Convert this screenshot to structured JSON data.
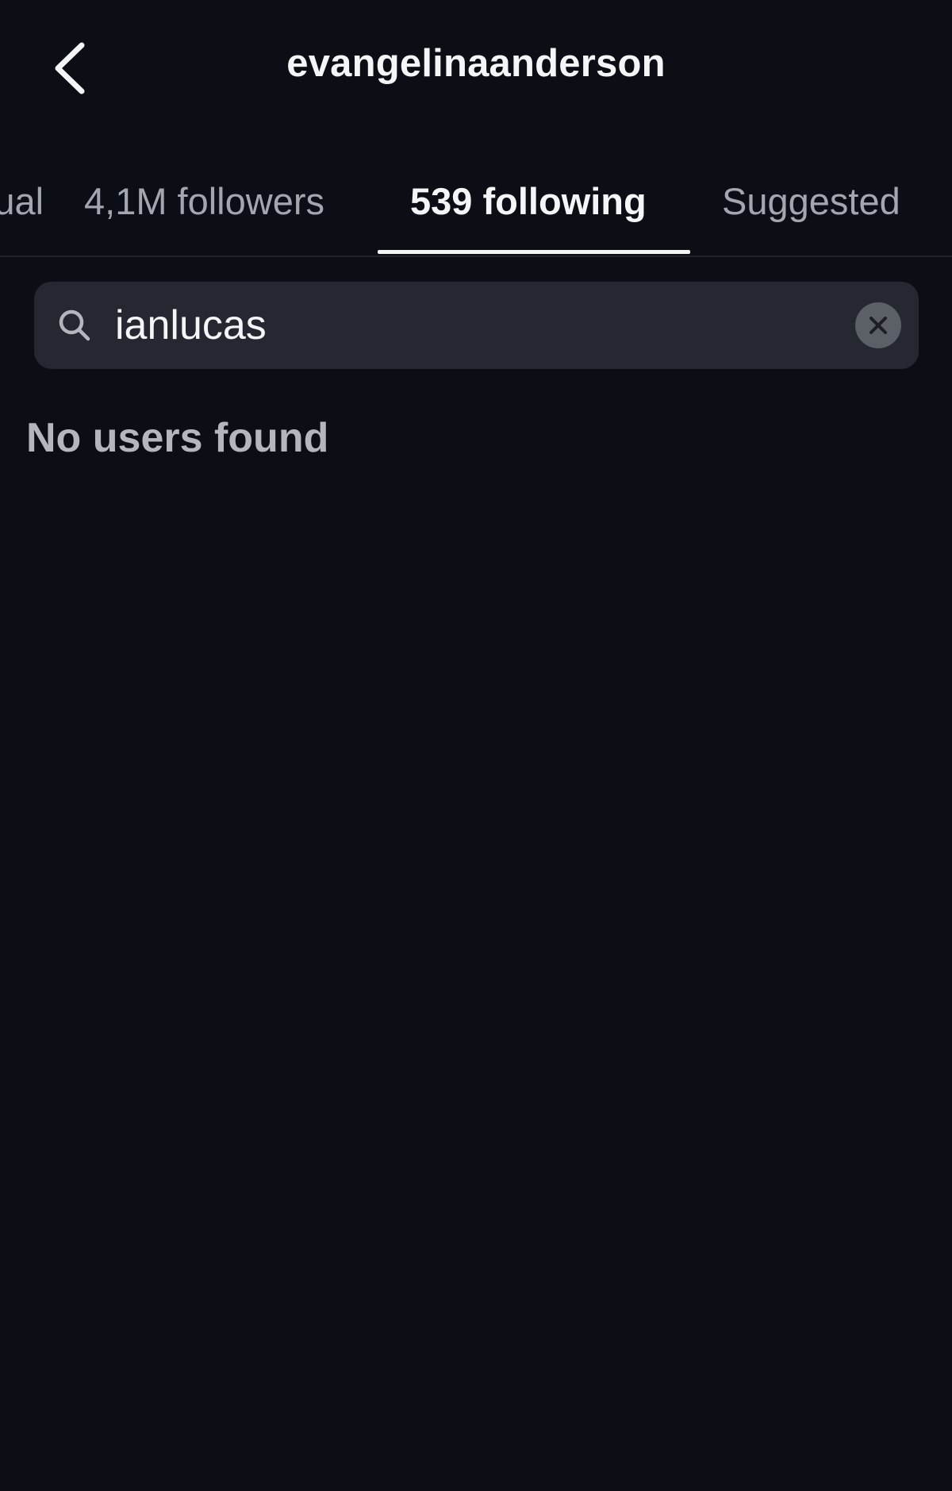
{
  "header": {
    "title": "evangelinaanderson",
    "back_icon": "chevron-left-icon"
  },
  "tabs": [
    {
      "label": "Mutual",
      "active": false
    },
    {
      "label": "4,1M followers",
      "active": false
    },
    {
      "label": "539 following",
      "active": true
    },
    {
      "label": "Suggested",
      "active": false
    }
  ],
  "search": {
    "value": "ianlucas",
    "icon": "search-icon",
    "clear_icon": "close-icon"
  },
  "results": {
    "empty_message": "No users found"
  },
  "colors": {
    "background": "#0b0e15",
    "search_field": "#252830",
    "text_primary": "#f4f5f7",
    "text_secondary": "#a2a6ae"
  }
}
